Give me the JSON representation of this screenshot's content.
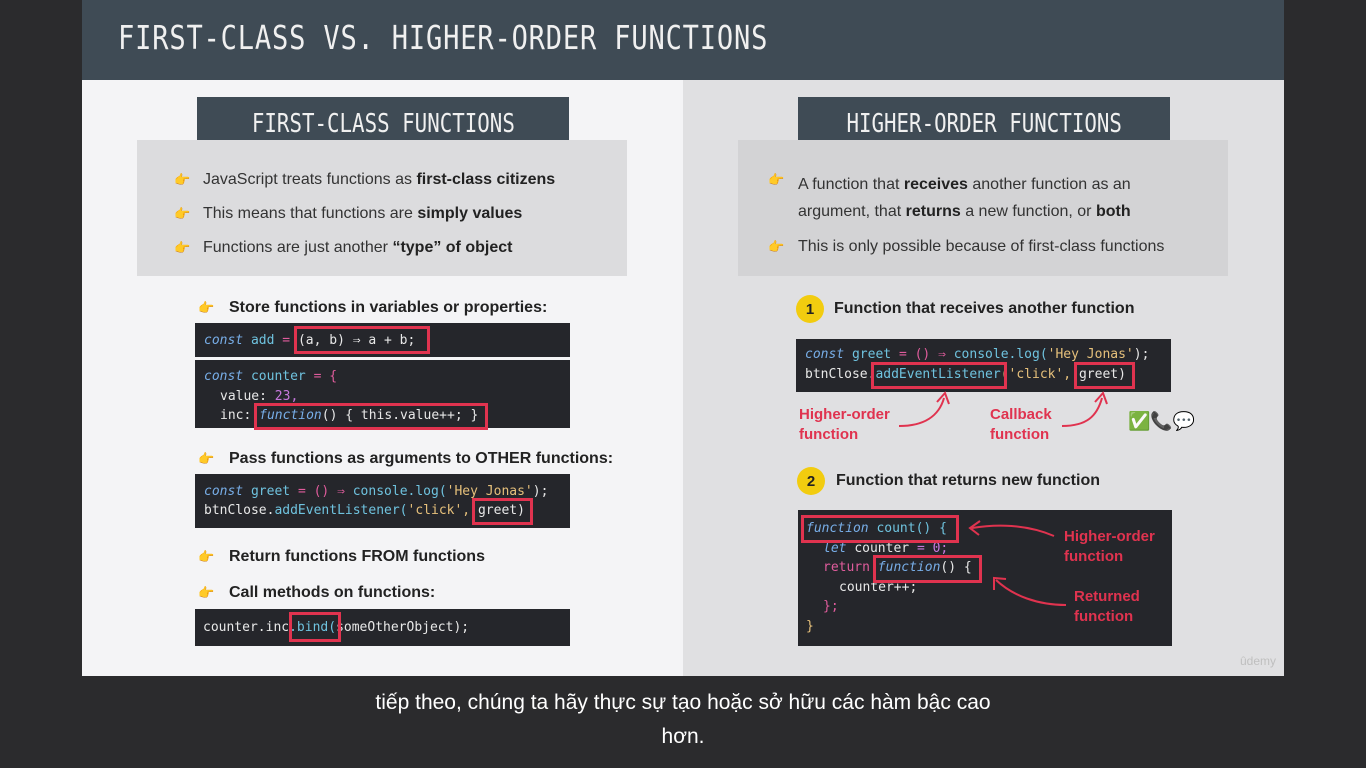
{
  "slide": {
    "title": "FIRST-CLASS VS. HIGHER-ORDER FUNCTIONS",
    "watermark": "ûdemy"
  },
  "left": {
    "header": "FIRST-CLASS FUNCTIONS",
    "bullets": [
      {
        "pre": "JavaScript treats functions as ",
        "bold": "first-class citizens",
        "post": ""
      },
      {
        "pre": "This means that functions are ",
        "bold": "simply values",
        "post": ""
      },
      {
        "pre": "Functions are just another ",
        "bold": "“type” of object",
        "post": ""
      }
    ],
    "sub_bullets": [
      "Store functions in variables or properties:",
      "Pass functions as arguments to OTHER functions:",
      "Return functions FROM functions",
      "Call methods on functions:"
    ],
    "code1": {
      "kw": "const",
      "name": "add",
      "eq": "=",
      "body": "(a, b) ⇒ a + b;"
    },
    "code2": {
      "line1": {
        "kw": "const",
        "name": "counter",
        "rest": "= {"
      },
      "line2": {
        "key": "value:",
        "val": "23,"
      },
      "line3": {
        "key": "inc:",
        "fn": "function",
        "body": "() { this.value++; }"
      }
    },
    "code3": {
      "line1": {
        "kw": "const",
        "name": "greet",
        "mid": "= () ⇒",
        "call": "console.log(",
        "str": "'Hey Jonas'",
        "end": ");"
      },
      "line2": {
        "obj": "btnClose.",
        "method": "addEventListener(",
        "str": "'click',",
        "arg": "greet)"
      }
    },
    "code4": {
      "obj": "counter.inc",
      "method": ".bind(",
      "arg": "someOtherObject);"
    }
  },
  "right": {
    "header": "HIGHER-ORDER FUNCTIONS",
    "bullet1": {
      "a": "A function that ",
      "b": "receives",
      "c": " another function as an",
      "d": "argument, that ",
      "e": "returns",
      "f": " a new function, or ",
      "g": "both"
    },
    "bullet2": "This is only possible because of first-class functions",
    "point1": {
      "num": "1",
      "text": "Function that receives another function"
    },
    "point2": {
      "num": "2",
      "text": "Function that returns new function"
    },
    "code5": {
      "line1": {
        "kw": "const",
        "name": "greet",
        "mid": "= () ⇒",
        "call": "console.log(",
        "str": "'Hey Jonas'",
        "end": ");"
      },
      "line2": {
        "obj": "btnClose.",
        "method": "addEventListener",
        "str": "('click',",
        "arg": "greet)"
      }
    },
    "labels": {
      "hof1": "Higher-order\nfunction",
      "callback": "Callback\nfunction",
      "hof2": "Higher-order\nfunction",
      "returned": "Returned\nfunction"
    },
    "emojis": "✅📞💬",
    "code6": {
      "line1": {
        "kw": "function",
        "name": "count() {"
      },
      "line2": {
        "kw": "let",
        "name": "counter",
        "rest": "= 0;"
      },
      "line3": {
        "ret": "return",
        "fn": "function",
        "rest": "() {"
      },
      "line4": {
        "text": "counter++;"
      },
      "line5": {
        "text": "};"
      },
      "line6": {
        "text": "}"
      }
    }
  },
  "subtitle": {
    "line1": "tiếp theo, chúng ta hãy thực sự tạo hoặc sở hữu các hàm bậc cao",
    "line2": "hơn."
  }
}
